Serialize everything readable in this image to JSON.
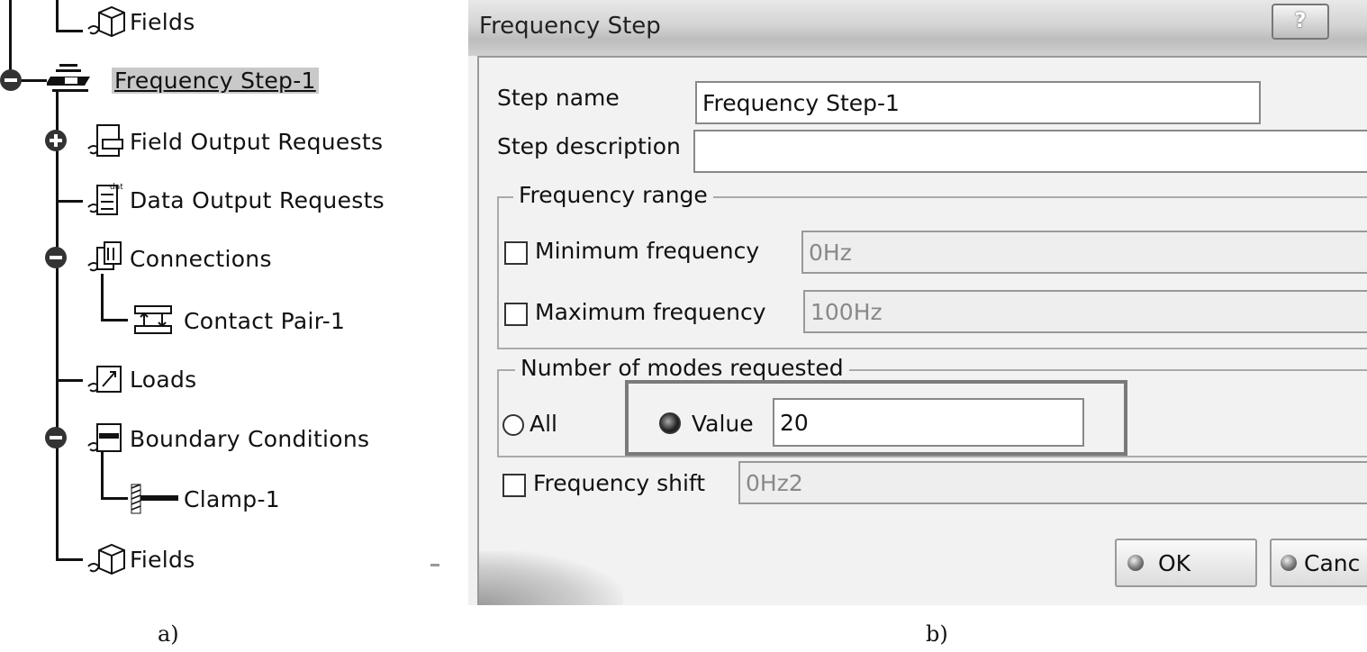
{
  "tree": {
    "items": [
      {
        "label": "Fields",
        "icon": "fields-icon"
      },
      {
        "label": "Frequency Step-1",
        "icon": "frequency-step-icon",
        "selected": true
      },
      {
        "label": "Field Output Requests",
        "icon": "field-output-icon"
      },
      {
        "label": "Data Output Requests",
        "icon": "data-output-icon"
      },
      {
        "label": "Connections",
        "icon": "connections-icon"
      },
      {
        "label": "Contact Pair-1",
        "icon": "contact-pair-icon"
      },
      {
        "label": "Loads",
        "icon": "loads-icon"
      },
      {
        "label": "Boundary Conditions",
        "icon": "boundary-conditions-icon"
      },
      {
        "label": "Clamp-1",
        "icon": "clamp-icon"
      },
      {
        "label": "Fields",
        "icon": "fields-icon"
      }
    ]
  },
  "captions": {
    "a": "a)",
    "b": "b)"
  },
  "dialog": {
    "title": "Frequency Step",
    "help_label": "?",
    "step_name_label": "Step name",
    "step_name_value": "Frequency Step-1",
    "step_description_label": "Step description",
    "step_description_value": "",
    "frequency_range": {
      "legend": "Frequency range",
      "min_label": "Minimum frequency",
      "min_value": "0Hz",
      "min_checked": false,
      "max_label": "Maximum frequency",
      "max_value": "100Hz",
      "max_checked": false
    },
    "modes": {
      "legend": "Number of modes requested",
      "all_label": "All",
      "value_label": "Value",
      "value": "20",
      "selected": "Value"
    },
    "frequency_shift_label": "Frequency shift",
    "frequency_shift_value": "0Hz2",
    "frequency_shift_checked": false,
    "ok_label": "OK",
    "cancel_label": "Canc"
  }
}
